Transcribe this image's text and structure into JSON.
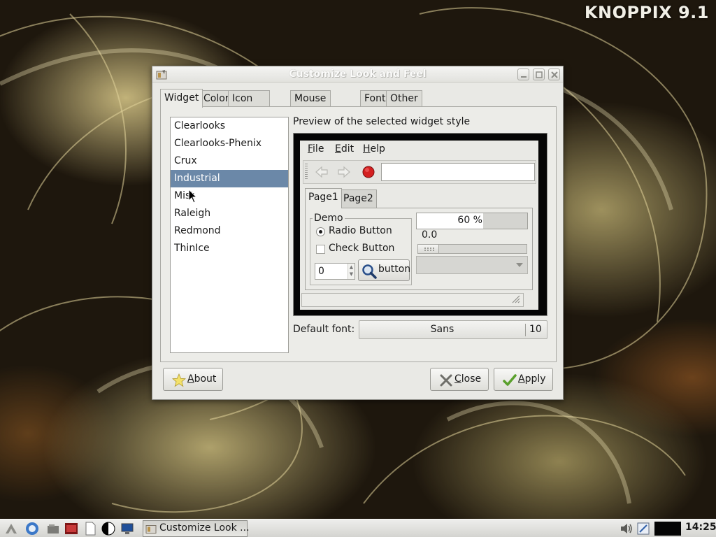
{
  "desktop": {
    "brand": "KNOPPIX 9.1"
  },
  "window": {
    "title": "Customize Look and Feel",
    "icon": "appearance-icon",
    "buttons": [
      "minimize-icon",
      "maximize-icon",
      "close-icon"
    ]
  },
  "tabs": [
    {
      "label": "Widget",
      "active": true
    },
    {
      "label": "Color",
      "active": false
    },
    {
      "label": "Icon Theme",
      "active": false
    },
    {
      "label": "Mouse Cursor",
      "active": false
    },
    {
      "label": "Font",
      "active": false
    },
    {
      "label": "Other",
      "active": false
    }
  ],
  "themes": {
    "items": [
      "Clearlooks",
      "Clearlooks-Phenix",
      "Crux",
      "Industrial",
      "Mist",
      "Raleigh",
      "Redmond",
      "ThinIce"
    ],
    "selected": "Industrial"
  },
  "preview": {
    "label": "Preview of the selected widget style",
    "menu": [
      {
        "underline": "F",
        "rest": "ile"
      },
      {
        "underline": "E",
        "rest": "dit"
      },
      {
        "underline": "H",
        "rest": "elp"
      }
    ],
    "toolbar_icons": [
      "back-arrow-icon",
      "forward-arrow-icon",
      "stop-record-icon"
    ],
    "inner_tabs": [
      {
        "label": "Page1",
        "active": true
      },
      {
        "label": "Page2",
        "active": false
      }
    ],
    "demo_group": "Demo",
    "radio_label": "Radio Button",
    "radio_checked": true,
    "check_label": "Check Button",
    "check_checked": false,
    "spin_value": "0",
    "button_label": "button",
    "progress_text": "60 %",
    "progress_fraction": 0.6,
    "scale_value": "0.0"
  },
  "font": {
    "label": "Default font:",
    "name": "Sans",
    "size": "10"
  },
  "buttons": {
    "about": "About",
    "close": "Close",
    "apply": "Apply"
  },
  "taskbar": {
    "task_label": "Customize Look ...",
    "clock": "14:25"
  },
  "colors": {
    "selection": "#6b88a8",
    "window_bg": "#e9e9e5"
  }
}
